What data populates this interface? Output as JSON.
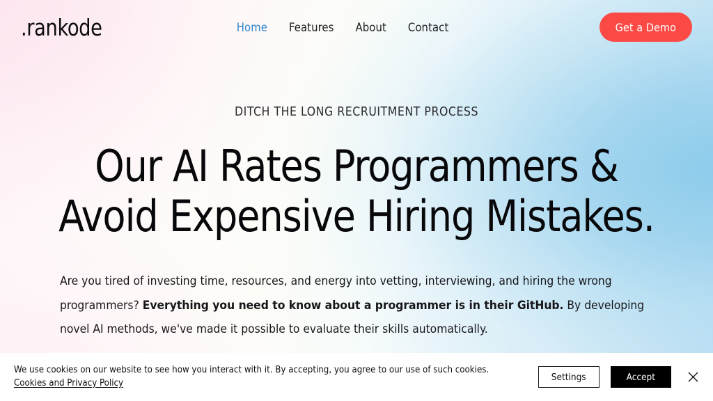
{
  "brand": {
    "logo_text": ".rankode",
    "accent_color": "#fb4a46",
    "link_active_color": "#2e86c8"
  },
  "header": {
    "nav_items": [
      {
        "label": "Home",
        "active": true,
        "name": "nav-link-home"
      },
      {
        "label": "Features",
        "active": false,
        "name": "nav-link-features"
      },
      {
        "label": "About",
        "active": false,
        "name": "nav-link-about"
      },
      {
        "label": "Contact",
        "active": false,
        "name": "nav-link-contact"
      }
    ],
    "cta_label": "Get a Demo"
  },
  "hero": {
    "eyebrow": "DITCH THE LONG RECRUITMENT PROCESS",
    "headline_line1": "Our AI Rates Programmers &",
    "headline_line2": "Avoid Expensive Hiring Mistakes.",
    "subcopy_part1": "Are you tired of investing time, resources, and energy into vetting, interviewing, and hiring the wrong programmers? ",
    "subcopy_bold": "Everything you need to know about a programmer is in their GitHub.",
    "subcopy_part2": " By developing novel AI methods, we've made it possible to evaluate their skills automatically."
  },
  "cookie_banner": {
    "message": "We use cookies on our website to see how you interact with it. By accepting, you agree to our use of such cookies. ",
    "policy_link_label": "Cookies and Privacy Policy",
    "settings_label": "Settings",
    "accept_label": "Accept",
    "close_icon": "close-icon"
  }
}
